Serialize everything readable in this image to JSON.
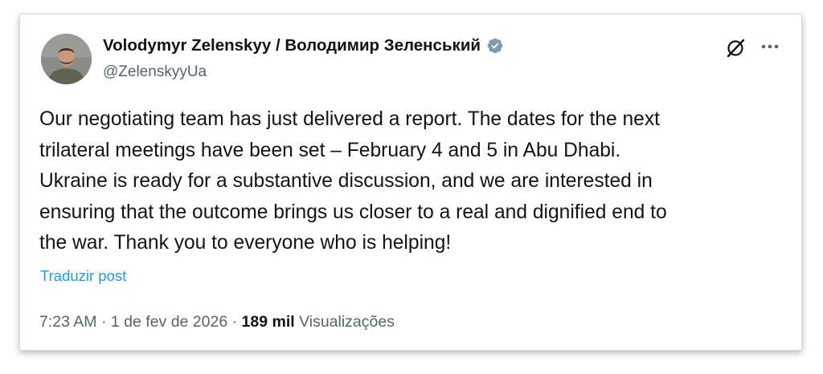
{
  "author": {
    "display_name": "Volodymyr Zelenskyy / Володимир Зеленський",
    "handle": "@ZelenskyyUa",
    "verified_icon": "verified-badge-icon",
    "verified_color": "#829aab"
  },
  "header_actions": {
    "grok_icon": "grok-icon",
    "more_icon": "more-dots-icon"
  },
  "post": {
    "text": "Our negotiating team has just delivered a report. The dates for the next\ntrilateral meetings have been set – February 4 and 5 in Abu Dhabi.\nUkraine is ready for a substantive discussion, and we are interested in\nensuring that the outcome brings us closer to a real and dignified end to\nthe war. Thank you to everyone who is helping!",
    "translate_label": "Traduzir post"
  },
  "meta": {
    "time": "7:23 AM",
    "separator": " · ",
    "date": "1 de fev de 2026",
    "views_count": "189 mil",
    "views_label": "Visualizações"
  },
  "colors": {
    "text_primary": "#0f1419",
    "text_secondary": "#536471",
    "link": "#1d9bf0"
  }
}
